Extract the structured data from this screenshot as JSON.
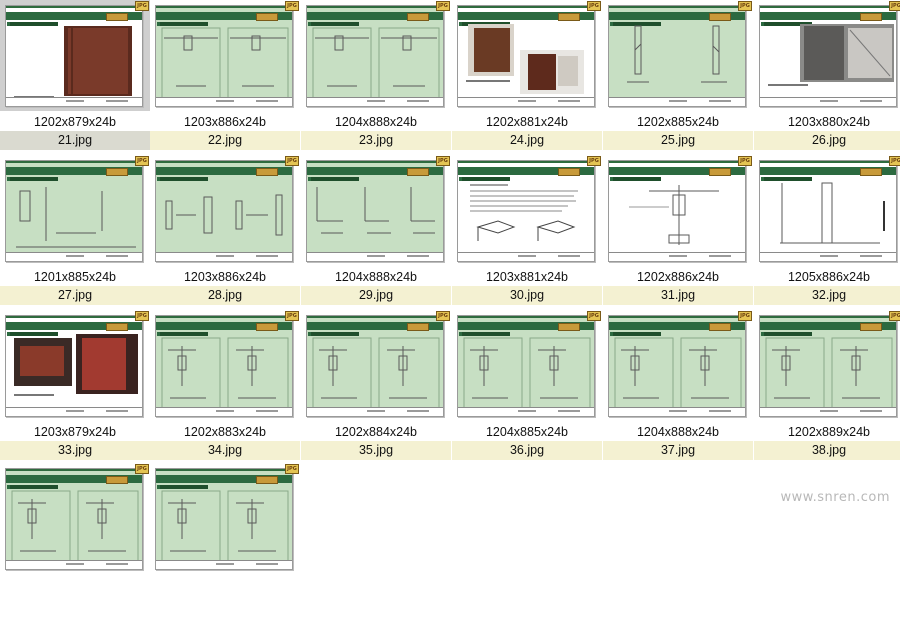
{
  "thumbnails": [
    {
      "filename": "21.jpg",
      "dims": "1202x879x24b",
      "selected": true,
      "variant": "photo-door"
    },
    {
      "filename": "22.jpg",
      "dims": "1203x886x24b",
      "variant": "two-section"
    },
    {
      "filename": "23.jpg",
      "dims": "1204x888x24b",
      "variant": "two-section"
    },
    {
      "filename": "24.jpg",
      "dims": "1202x881x24b",
      "variant": "photo-panels"
    },
    {
      "filename": "25.jpg",
      "dims": "1202x885x24b",
      "variant": "joints"
    },
    {
      "filename": "26.jpg",
      "dims": "1203x880x24b",
      "variant": "photo-wall"
    },
    {
      "filename": "27.jpg",
      "dims": "1201x885x24b",
      "variant": "elevation"
    },
    {
      "filename": "28.jpg",
      "dims": "1203x886x24b",
      "variant": "profiles"
    },
    {
      "filename": "29.jpg",
      "dims": "1204x888x24b",
      "variant": "three-section"
    },
    {
      "filename": "30.jpg",
      "dims": "1203x881x24b",
      "variant": "text-diagram"
    },
    {
      "filename": "31.jpg",
      "dims": "1202x886x24b",
      "variant": "detail-white"
    },
    {
      "filename": "32.jpg",
      "dims": "1205x886x24b",
      "variant": "door-frame"
    },
    {
      "filename": "33.jpg",
      "dims": "1203x879x24b",
      "variant": "photo-red"
    },
    {
      "filename": "34.jpg",
      "dims": "1202x883x24b",
      "variant": "two-detail"
    },
    {
      "filename": "35.jpg",
      "dims": "1202x884x24b",
      "variant": "two-detail"
    },
    {
      "filename": "36.jpg",
      "dims": "1204x885x24b",
      "variant": "two-detail"
    },
    {
      "filename": "37.jpg",
      "dims": "1204x888x24b",
      "variant": "two-detail"
    },
    {
      "filename": "38.jpg",
      "dims": "1202x889x24b",
      "variant": "two-detail"
    },
    {
      "filename": "",
      "dims": "",
      "variant": "two-detail"
    },
    {
      "filename": "",
      "dims": "",
      "variant": "two-detail"
    }
  ],
  "badge_label": "JPG",
  "watermark": "www.snren.com"
}
